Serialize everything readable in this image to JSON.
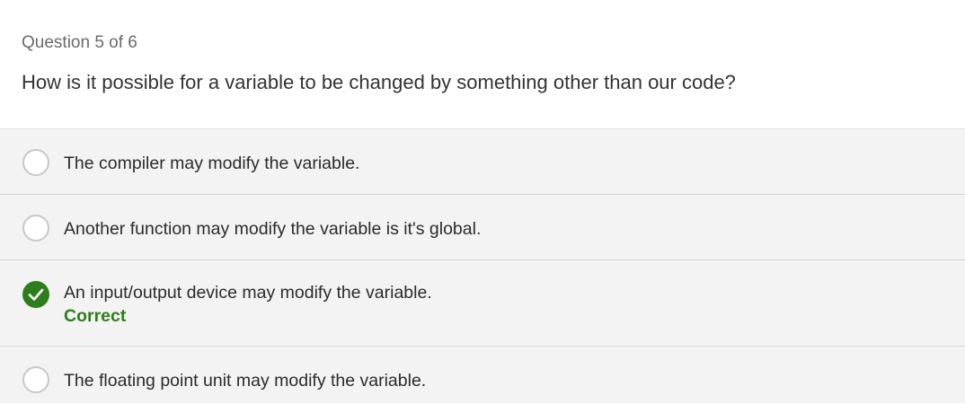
{
  "quiz": {
    "progress_label": "Question 5 of 6",
    "question": "How is it possible for a variable to be changed by something other than our code?",
    "options": [
      {
        "label": "The compiler may modify the variable.",
        "selected": false
      },
      {
        "label": "Another function may modify the variable is it's global.",
        "selected": false
      },
      {
        "label": "An input/output device may modify the variable.",
        "selected": true,
        "feedback": "Correct"
      },
      {
        "label": "The floating point unit may modify the variable.",
        "selected": false
      }
    ],
    "colors": {
      "correct": "#2e7d1c",
      "options_background": "#f3f3f3"
    },
    "icons": {
      "unselected": "radio-empty-icon",
      "selected_correct": "checkmark-icon"
    }
  }
}
